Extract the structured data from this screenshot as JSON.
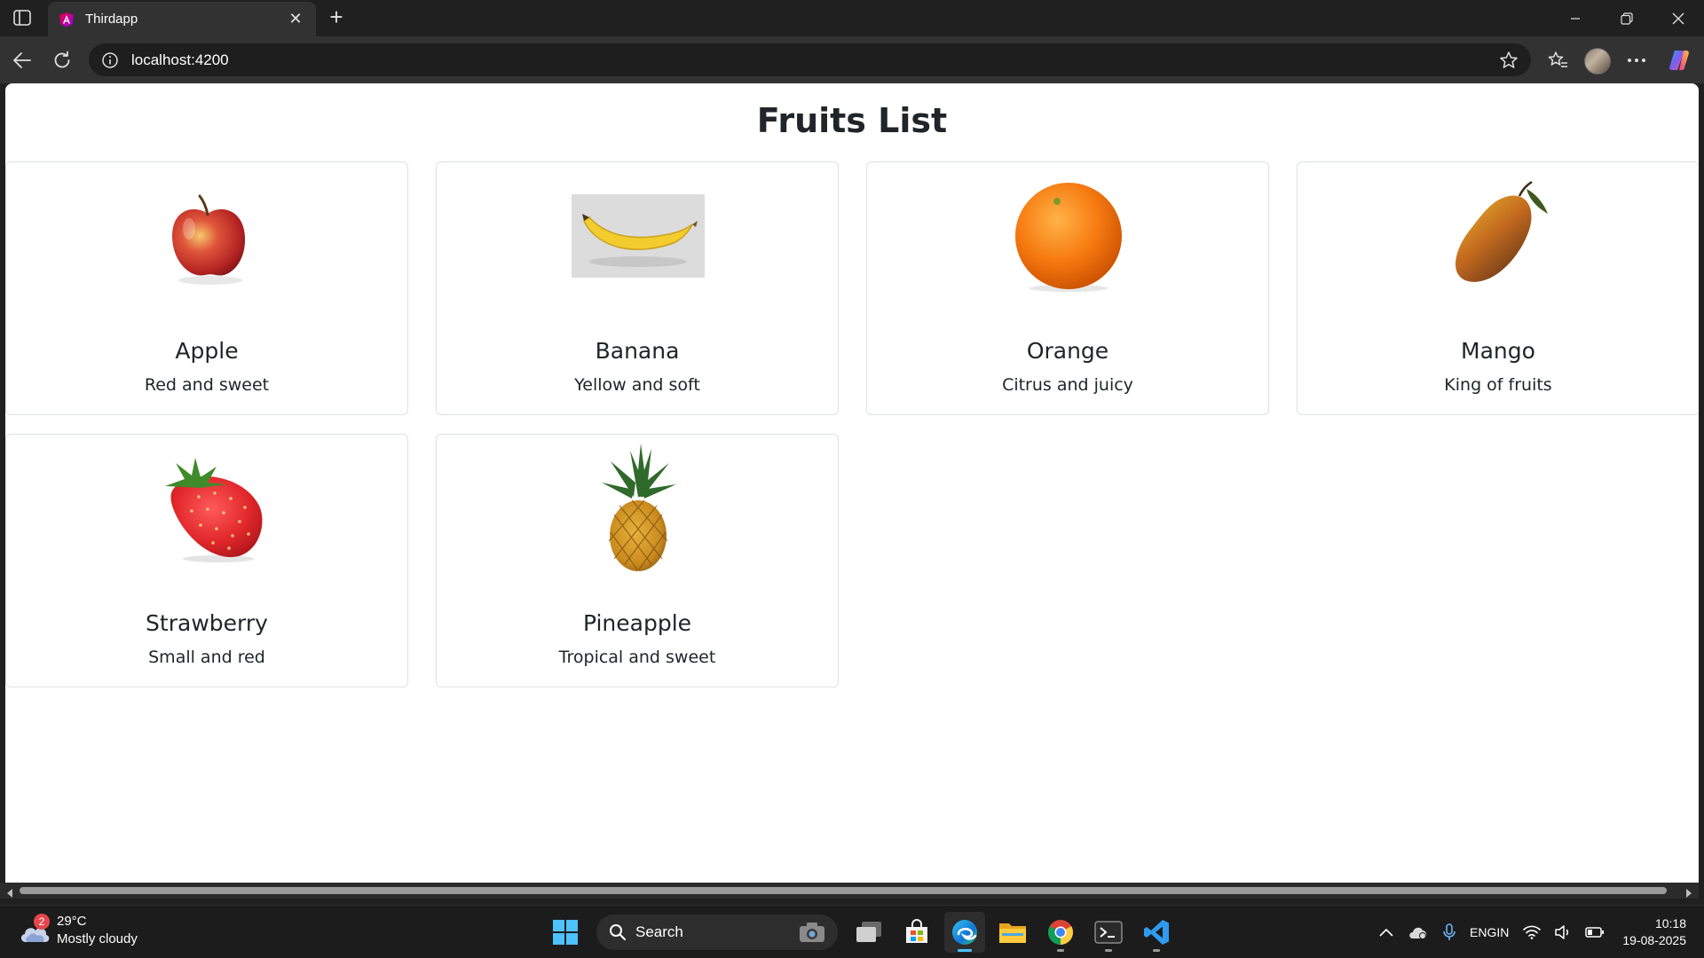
{
  "browser": {
    "tab_title": "Thirdapp",
    "new_tab_symbol": "+",
    "close_symbol": "✕",
    "url": "localhost:4200"
  },
  "page": {
    "title": "Fruits List",
    "fruits": [
      {
        "name": "Apple",
        "description": "Red and sweet",
        "icon": "apple-image"
      },
      {
        "name": "Banana",
        "description": "Yellow and soft",
        "icon": "banana-image"
      },
      {
        "name": "Orange",
        "description": "Citrus and juicy",
        "icon": "orange-image"
      },
      {
        "name": "Mango",
        "description": "King of fruits",
        "icon": "mango-image"
      },
      {
        "name": "Strawberry",
        "description": "Small and red",
        "icon": "strawberry-image"
      },
      {
        "name": "Pineapple",
        "description": "Tropical and sweet",
        "icon": "pineapple-image"
      }
    ]
  },
  "taskbar": {
    "weather": {
      "badge": "2",
      "temperature": "29°C",
      "condition": "Mostly cloudy"
    },
    "search_label": "Search",
    "language": {
      "line1": "ENG",
      "line2": "IN"
    },
    "time": "10:18",
    "date": "19-08-2025"
  },
  "colors": {
    "chrome_dark": "#202020",
    "toolbar": "#323232",
    "page_background": "#ffffff",
    "card_border": "#dee2e6",
    "text": "#212529",
    "accent": "#4cc2ff"
  }
}
